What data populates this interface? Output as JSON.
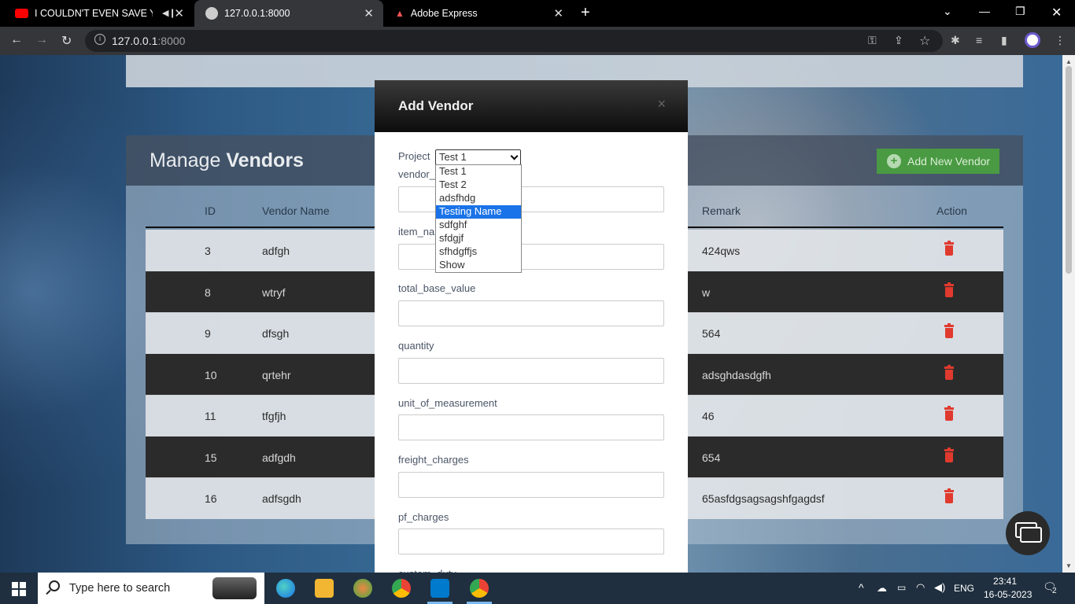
{
  "browser": {
    "tabs": [
      {
        "title": "I COULDN'T EVEN SAVE YOU"
      },
      {
        "title": "127.0.0.1:8000"
      },
      {
        "title": "Adobe Express"
      }
    ],
    "url_host": "127.0.0.1",
    "url_port": ":8000"
  },
  "vendors": {
    "title_light": "Manage",
    "title_bold": "Vendors",
    "add_button_label": "Add New Vendor",
    "columns": [
      "ID",
      "Vendor Name",
      "Remark",
      "Action"
    ],
    "rows": [
      {
        "id": "3",
        "name": "adfgh",
        "remark": "424qws"
      },
      {
        "id": "8",
        "name": "wtryf",
        "remark": "w"
      },
      {
        "id": "9",
        "name": "dfsgh",
        "remark": "564"
      },
      {
        "id": "10",
        "name": "qrtehr",
        "remark": "adsghdasdgfh"
      },
      {
        "id": "11",
        "name": "tfgfjh",
        "remark": "46"
      },
      {
        "id": "15",
        "name": "adfgdh",
        "remark": "654"
      },
      {
        "id": "16",
        "name": "adfsgdh",
        "remark": "65asfdgsagsagshfgagdsf"
      }
    ]
  },
  "modal": {
    "title": "Add Vendor",
    "close": "×",
    "project_label": "Project",
    "project_value": "Test 1",
    "project_options": [
      "Test 1",
      "Test 2",
      "adsfhdg",
      "Testing Name",
      "sdfghf",
      "sfdgjf",
      "sfhdgffjs",
      "Show"
    ],
    "selected_option_index": 3,
    "fields": [
      {
        "label": "vendor_"
      },
      {
        "label": "item_na"
      },
      {
        "label": "total_base_value"
      },
      {
        "label": "quantity"
      },
      {
        "label": "unit_of_measurement"
      },
      {
        "label": "freight_charges"
      },
      {
        "label": "pf_charges"
      },
      {
        "label": "custom_duty"
      }
    ]
  },
  "taskbar": {
    "search_placeholder": "Type here to search",
    "language": "ENG",
    "time": "23:41",
    "date": "16-05-2023",
    "notification_count": "2"
  },
  "colors": {
    "accent_green": "#4a9a43",
    "delete_red": "#e03a2e",
    "option_highlight": "#1a73e8"
  }
}
